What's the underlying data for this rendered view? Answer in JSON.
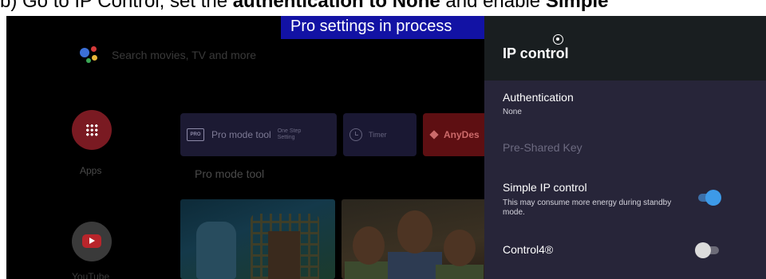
{
  "caption": {
    "prefix": "b)  Go to IP Control, set the ",
    "bold1": "authentication to None",
    "middle": " and enable ",
    "bold2": "Simple"
  },
  "banner": {
    "text": "Pro settings in process"
  },
  "launcher": {
    "search_placeholder": "Search movies, TV and more",
    "apps_label": "Apps",
    "youtube_label": "YouTube",
    "cards": {
      "pro_badge": "PRO",
      "pro_mode_title": "Pro mode tool",
      "pro_mode_sub": "One Step Setting",
      "timer_title": "Timer",
      "anydesk_title": "AnyDes"
    },
    "row_label": "Pro mode tool"
  },
  "panel": {
    "title": "IP control",
    "authentication": {
      "label": "Authentication",
      "value": "None"
    },
    "pre_shared_key": {
      "label": "Pre-Shared Key"
    },
    "simple_ip": {
      "label": "Simple IP control",
      "description": "This may consume more energy during standby mode.",
      "enabled": true
    },
    "control4": {
      "label": "Control4®",
      "enabled": false
    }
  },
  "colors": {
    "banner_bg": "#1212a4",
    "panel_bg": "#272539",
    "panel_header_bg": "#191e20",
    "toggle_on": "#3d9ae8",
    "toggle_off": "#dcdcdc"
  }
}
